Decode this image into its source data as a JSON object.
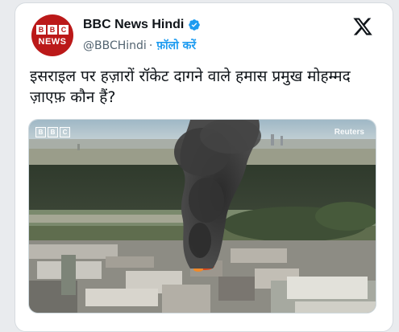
{
  "tweet": {
    "avatar": {
      "letters": [
        "B",
        "B",
        "C"
      ],
      "news": "NEWS"
    },
    "display_name": "BBC News Hindi",
    "handle": "@BBCHindi",
    "separator": "·",
    "follow_label": "फ़ॉलो करें",
    "text": "इसराइल पर हज़ारों रॉकेट दागने वाले हमास प्रमुख मोहम्मद ज़ाएफ़ कौन हैं?",
    "media": {
      "watermark_letters": [
        "B",
        "B",
        "C"
      ],
      "credit": "Reuters"
    }
  },
  "colors": {
    "brand": "#bb1919",
    "accent": "#1d9bf0",
    "text": "#0f1419",
    "muted": "#536471"
  },
  "icons": [
    "verified-badge-icon",
    "x-logo-icon"
  ]
}
